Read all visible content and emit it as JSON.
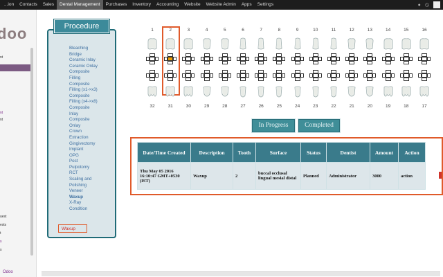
{
  "topbar": {
    "menu": [
      "Sales",
      "Dental Management",
      "Purchases",
      "Inventory",
      "Accounting",
      "Website",
      "Website Admin",
      "Apps",
      "Settings"
    ],
    "menu_cutoff_left": [
      "Contacts"
    ],
    "prefix": "...ion",
    "active_index": 1
  },
  "sidebar": {
    "logo": "doo",
    "items": [
      {
        "label": "nt",
        "purple": false
      },
      {
        "label": "nt",
        "purple": true
      },
      {
        "label": "nt",
        "purple": false
      },
      {
        "label": "uest",
        "purple": false
      },
      {
        "label": "ests",
        "purple": false
      },
      {
        "label": "t",
        "purple": false
      },
      {
        "label": "s",
        "purple": true
      },
      {
        "label": "s",
        "purple": false
      }
    ],
    "footer": "Odoo"
  },
  "procedure": {
    "title": "Procedure",
    "items": [
      {
        "label": "Bleaching",
        "bold": false
      },
      {
        "label": "Bridge",
        "bold": false
      },
      {
        "label": "Ceramic Inlay",
        "bold": false
      },
      {
        "label": "Ceramic Onlay",
        "bold": false
      },
      {
        "label": "Composite",
        "bold": false
      },
      {
        "label": "Filling",
        "bold": false
      },
      {
        "label": "Composite",
        "bold": false
      },
      {
        "label": "Filling (x1->x3)",
        "bold": false
      },
      {
        "label": "Composite",
        "bold": false
      },
      {
        "label": "Filling (x4->x8)",
        "bold": false
      },
      {
        "label": "Composite",
        "bold": false
      },
      {
        "label": "Inlay",
        "bold": false
      },
      {
        "label": "Composite",
        "bold": false
      },
      {
        "label": "Onlay",
        "bold": false
      },
      {
        "label": "Crown",
        "bold": false
      },
      {
        "label": "Extraction",
        "bold": false
      },
      {
        "label": "Gingivectomy",
        "bold": false
      },
      {
        "label": "Implant",
        "bold": false
      },
      {
        "label": "OPG",
        "bold": false
      },
      {
        "label": "Post",
        "bold": false
      },
      {
        "label": "Pulpotomy",
        "bold": false
      },
      {
        "label": "RCT",
        "bold": false
      },
      {
        "label": "Scaling and",
        "bold": false
      },
      {
        "label": "Polishing",
        "bold": false
      },
      {
        "label": "Veneer",
        "bold": false
      },
      {
        "label": "Waxup",
        "bold": true
      },
      {
        "label": "X-Ray",
        "bold": false
      },
      {
        "label": "Condition",
        "bold": false
      }
    ],
    "selected": "Waxup"
  },
  "teeth": {
    "upper": [
      "1",
      "2",
      "3",
      "4",
      "5",
      "6",
      "7",
      "8",
      "9",
      "10",
      "11",
      "12",
      "13",
      "14",
      "15",
      "16"
    ],
    "lower": [
      "32",
      "31",
      "30",
      "29",
      "28",
      "27",
      "26",
      "25",
      "24",
      "23",
      "22",
      "21",
      "20",
      "19",
      "18",
      "17"
    ],
    "selected_tooth": "2",
    "selected_color": "#f0a000"
  },
  "buttons": {
    "in_progress": "In Progress",
    "completed": "Completed"
  },
  "table": {
    "headers": [
      "Date/Time Created",
      "Description",
      "Tooth",
      "Surface",
      "Status",
      "Dentist",
      "Amount",
      "Action"
    ],
    "rows": [
      {
        "date": "Thu May 05 2016 16:10:47 GMT+0530 (IST)",
        "description": "Waxup",
        "tooth": "2",
        "surface": "buccal occlusal lingual mesial distal",
        "status": "Planned",
        "dentist": "Administrator",
        "amount": "3000",
        "action": "action"
      }
    ]
  },
  "colors": {
    "accent": "#3a7b8b",
    "highlight": "#e05a2a",
    "panel": "#dbe6ea"
  }
}
